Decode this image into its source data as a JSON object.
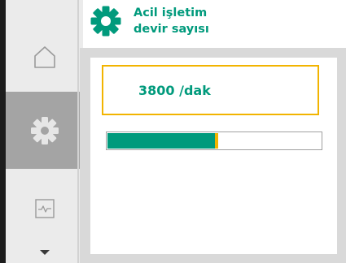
{
  "header": {
    "icon": "gear-icon",
    "title": "Acil işletim\ndevir sayısı"
  },
  "sidebar": {
    "items": [
      {
        "name": "home",
        "icon": "house-icon",
        "selected": false
      },
      {
        "name": "settings",
        "icon": "gear-icon",
        "selected": true
      },
      {
        "name": "diagnostics",
        "icon": "pulse-icon",
        "selected": false
      }
    ],
    "scroll_indicator": "chevron-down-icon"
  },
  "value_field": {
    "text": "3800 /dak"
  },
  "progress": {
    "fraction": 0.52
  },
  "colors": {
    "accent": "#009a7c",
    "focus": "#f2b400",
    "sidebar": "#ebebeb",
    "sidebar_selected": "#a4a4a4"
  }
}
